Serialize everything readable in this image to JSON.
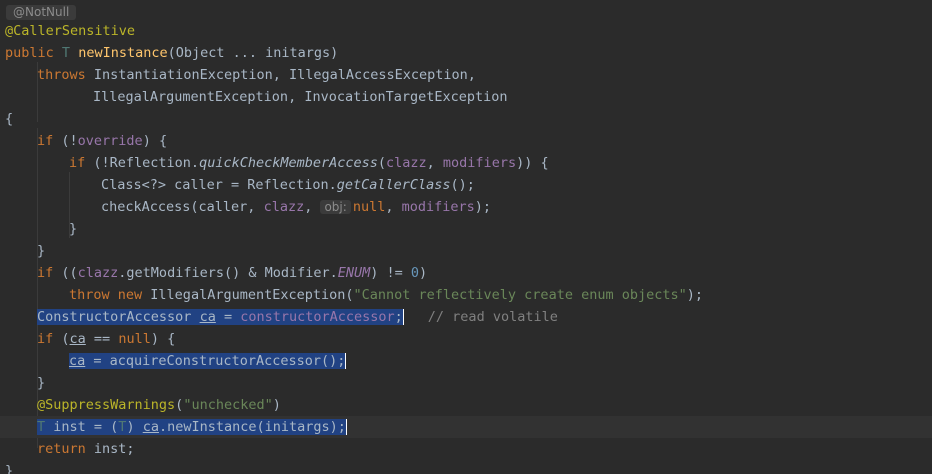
{
  "editor": {
    "hint_top": "@NotNull",
    "line1": {
      "annotation": "@CallerSensitive"
    },
    "line2": {
      "kw": "public",
      "type": "T",
      "method": "newInstance",
      "rest": "(Object ... initargs)"
    },
    "line3": {
      "kw": "throws",
      "text": " InstantiationException, IllegalAccessException,"
    },
    "line4": {
      "text": "IllegalArgumentException, InvocationTargetException"
    },
    "line5": {
      "text": "{"
    },
    "line6": {
      "kw": "if",
      "p1": " (!",
      "field": "override",
      "p2": ") {"
    },
    "line7": {
      "kw": "if",
      "p1": " (!Reflection.",
      "method": "quickCheckMemberAccess",
      "p2": "(",
      "field": "clazz",
      "p3": ", ",
      "field2": "modifiers",
      "p4": ")) {"
    },
    "line8": {
      "p1": "Class<?> caller = Reflection.",
      "method": "getCallerClass",
      "p2": "();"
    },
    "line9": {
      "p1": "checkAccess(caller, ",
      "field": "clazz",
      "p2": ", ",
      "hint": "obj:",
      "kw": "null",
      "p3": ", ",
      "field2": "modifiers",
      "p4": ");"
    },
    "line10": {
      "text": "}"
    },
    "line11": {
      "text": "}"
    },
    "line12": {
      "kw": "if",
      "p1": " ((",
      "field": "clazz",
      "p2": ".getModifiers() & Modifier.",
      "field2": "ENUM",
      "p3": ") != ",
      "num": "0",
      "p4": ")"
    },
    "line13": {
      "kw1": "throw",
      "kw2": "new",
      "p1": " IllegalArgumentException(",
      "str": "\"Cannot reflectively create enum objects\"",
      "p2": ");"
    },
    "line14": {
      "p1": "ConstructorAccessor ",
      "var": "ca",
      "p2": " = ",
      "field": "constructorAccessor",
      "p3": ";",
      "comment": "// read volatile"
    },
    "line15": {
      "kw": "if",
      "p1": " (",
      "var": "ca",
      "p2": " == ",
      "kw2": "null",
      "p3": ") {"
    },
    "line16": {
      "var": "ca",
      "p1": " = acquireConstructorAccessor();"
    },
    "line17": {
      "text": "}"
    },
    "line18": {
      "ann": "@SuppressWarnings",
      "p1": "(",
      "str": "\"unchecked\"",
      "p2": ")"
    },
    "line19": {
      "type": "T",
      "p1": " inst = (",
      "type2": "T",
      "p2": ") ",
      "var": "ca",
      "p3": ".newInstance(initargs);"
    },
    "line20": {
      "kw": "return",
      "p1": " inst;"
    },
    "line21": {
      "text": "}"
    }
  },
  "colors": {
    "background": "#2b2b2b",
    "selection": "#214283",
    "keyword": "#cc7832",
    "annotation": "#bbb529",
    "method": "#ffc66d",
    "field": "#9876aa",
    "string": "#6a8759",
    "number": "#6897bb",
    "comment": "#808080",
    "plain": "#a9b7c6",
    "type_param": "#507874"
  }
}
